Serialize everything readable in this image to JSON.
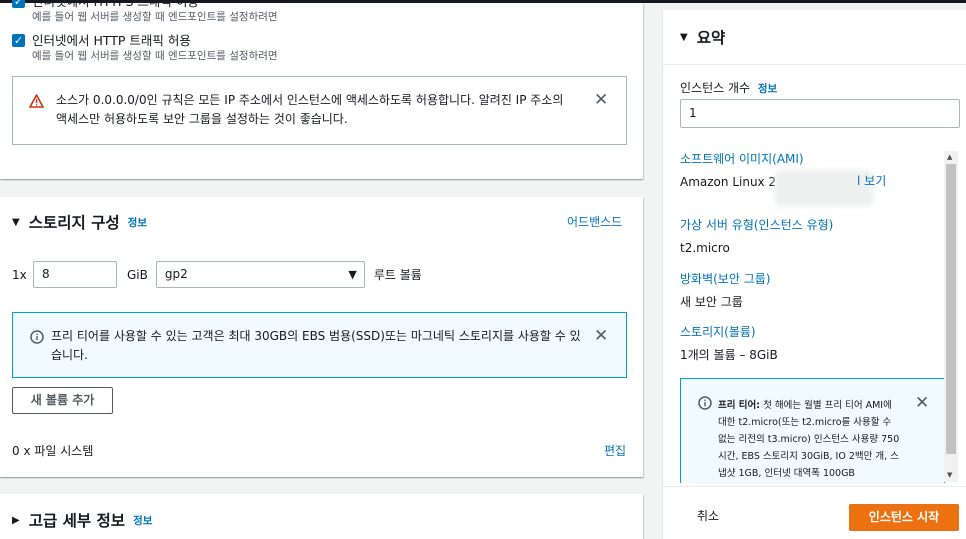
{
  "network": {
    "https_label": "인터넷에서 HTTPS 트래픽 허용",
    "https_desc": "예를 들어 웹 서버를 생성할 때 엔드포인트를 설정하려면",
    "http_label": "인터넷에서 HTTP 트래픽 허용",
    "http_desc": "예를 들어 웹 서버를 생성할 때 엔드포인트를 설정하려면",
    "warning": "소스가 0.0.0.0/0인 규칙은 모든 IP 주소에서 인스턴스에 액세스하도록 허용합니다. 알려진 IP 주소의 액세스만 허용하도록 보안 그룹을 설정하는 것이 좋습니다."
  },
  "storage": {
    "title": "스토리지 구성",
    "info": "정보",
    "advanced": "어드밴스드",
    "multiplier": "1x",
    "size": "8",
    "unit": "GiB",
    "volume_type": "gp2",
    "volume_label": "루트 볼륨",
    "free_tier_info": "프리 티어를 사용할 수 있는 고객은 최대 30GB의 EBS 범용(SSD)또는 마그네틱 스토리지를 사용할 수 있습니다.",
    "add_volume": "새 볼륨 추가",
    "file_systems": "0 x 파일 시스템",
    "edit": "편집"
  },
  "advanced": {
    "title": "고급 세부 정보",
    "info": "정보"
  },
  "summary": {
    "title": "요약",
    "instance_count_label": "인스턴스 개수",
    "info": "정보",
    "instance_count": "1",
    "ami_link": "소프트웨어 이미지(AMI)",
    "ami_value": "Amazon Linux 2",
    "ami_tail": "l 보기",
    "type_link": "가상 서버 유형(인스턴스 유형)",
    "type_value": "t2.micro",
    "firewall_link": "방화벽(보안 그룹)",
    "firewall_value": "새 보안 그룹",
    "storage_link": "스토리지(볼륨)",
    "storage_value": "1개의 볼륨 – 8GiB",
    "free_tier_label": "프리 티어:",
    "free_tier_text": "첫 해에는 월별 프리 티어 AMI에 대한 t2.micro(또는 t2.micro를 사용할 수 없는 리전의 t3.micro) 인스턴스 사용량 750시간, EBS 스토리지 30GiB, IO 2백만 개, 스냅샷 1GB, 인터넷 대역폭 100GB",
    "cancel": "취소",
    "launch": "인스턴스 시작"
  },
  "colors": {
    "link": "#0073bb",
    "primary_button": "#ec7211",
    "warning_icon": "#d13212",
    "info_border": "#00a1c9"
  }
}
